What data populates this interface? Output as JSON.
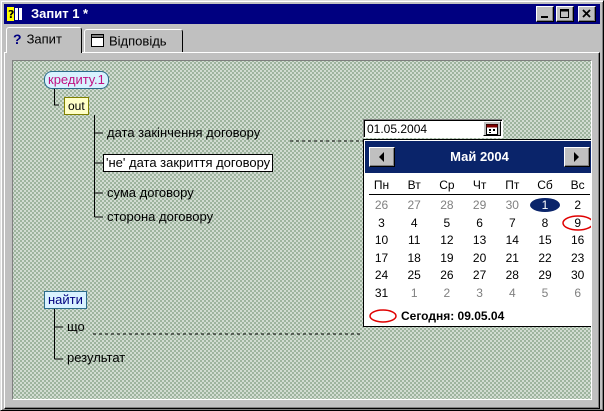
{
  "window": {
    "title": "Запит 1 *"
  },
  "tabs": [
    {
      "label": "Запит",
      "active": true,
      "icon": "question-mark-icon"
    },
    {
      "label": "Відповідь",
      "active": false,
      "icon": "table-icon"
    }
  ],
  "query": {
    "entity": "кредиту.1",
    "out_label": "out",
    "fields": [
      "дата закінчення договору",
      "'не' дата закриття договору",
      "сума договору",
      "сторона договору"
    ],
    "find_node": "найти",
    "find_fields": [
      "що",
      "результат"
    ]
  },
  "date_picker": {
    "value": "01.05.2004",
    "month_title": "Май 2004",
    "weekdays": [
      "Пн",
      "Вт",
      "Ср",
      "Чт",
      "Пт",
      "Сб",
      "Вс"
    ],
    "weeks": [
      [
        "26",
        "27",
        "28",
        "29",
        "30",
        "1",
        "2"
      ],
      [
        "3",
        "4",
        "5",
        "6",
        "7",
        "8",
        "9"
      ],
      [
        "10",
        "11",
        "12",
        "13",
        "14",
        "15",
        "16"
      ],
      [
        "17",
        "18",
        "19",
        "20",
        "21",
        "22",
        "23"
      ],
      [
        "24",
        "25",
        "26",
        "27",
        "28",
        "29",
        "30"
      ],
      [
        "31",
        "1",
        "2",
        "3",
        "4",
        "5",
        "6"
      ]
    ],
    "selected_day": "1",
    "today_day": "9",
    "today_text": "Сегодня: 09.05.04"
  },
  "colors": {
    "titlebar": "#000080",
    "calendar_header": "#0a246a",
    "entity_text": "#c01080",
    "today_circle": "#e00000"
  }
}
